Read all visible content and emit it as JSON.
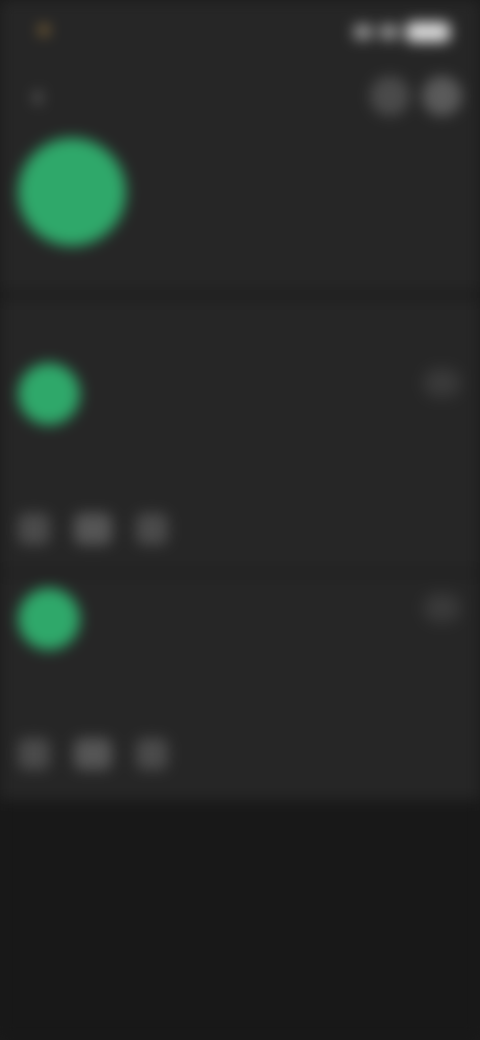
{
  "status_bar": {
    "time": "",
    "signal_icon": "signal-icon",
    "wifi_icon": "wifi-icon",
    "battery_icon": "battery-icon"
  },
  "nav": {
    "back_icon": "‹",
    "share_icon": "share-icon",
    "more_icon": "more-icon"
  },
  "profile": {
    "name": "",
    "stats": [
      {
        "num": "",
        "label": ""
      },
      {
        "num": "",
        "label": ""
      },
      {
        "num": "",
        "label": ""
      }
    ]
  },
  "section": {
    "title": ""
  },
  "posts": [
    {
      "author": "",
      "time": "",
      "text": "",
      "more_icon": "⋯"
    },
    {
      "author": "",
      "time": "",
      "text": "",
      "more_icon": "⋯"
    }
  ],
  "colors": {
    "accent": "#2fa86a",
    "background": "#262626",
    "bottom": "#181818"
  }
}
